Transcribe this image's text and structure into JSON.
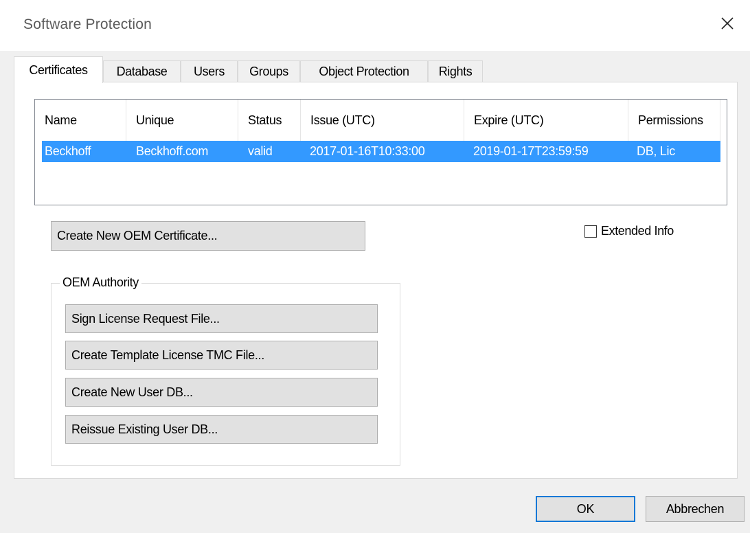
{
  "window": {
    "title": "Software Protection",
    "close_icon": "close-icon"
  },
  "tabs": [
    {
      "label": "Certificates",
      "active": true
    },
    {
      "label": "Database",
      "active": false
    },
    {
      "label": "Users",
      "active": false
    },
    {
      "label": "Groups",
      "active": false
    },
    {
      "label": "Object Protection",
      "active": false
    },
    {
      "label": "Rights",
      "active": false
    }
  ],
  "certificates": {
    "columns": [
      "Name",
      "Unique",
      "Status",
      "Issue (UTC)",
      "Expire (UTC)",
      "Permissions"
    ],
    "rows": [
      {
        "name": "Beckhoff",
        "unique": "Beckhoff.com",
        "status": "valid",
        "issue": "2017-01-16T10:33:00",
        "expire": "2019-01-17T23:59:59",
        "permissions": "DB, Lic"
      }
    ],
    "create_button": "Create New OEM Certificate...",
    "extended_info_label": "Extended Info",
    "extended_info_checked": false,
    "oem_authority": {
      "legend": "OEM Authority",
      "buttons": [
        "Sign License Request File...",
        "Create Template License TMC File...",
        "Create New User DB...",
        "Reissue Existing User DB..."
      ]
    }
  },
  "footer": {
    "ok_label": "OK",
    "cancel_label": "Abbrechen"
  },
  "colors": {
    "selection": "#3399ff",
    "default_button_border": "#0078d7",
    "window_bg": "#f0f0f0"
  }
}
